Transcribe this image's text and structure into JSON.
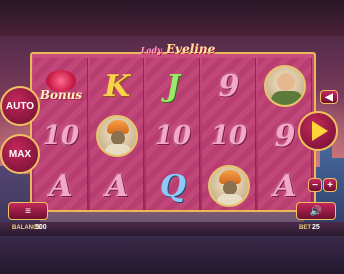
{
  "game": {
    "logo_text": "Eveline",
    "logo_prefix": "Lady"
  },
  "controls": {
    "auto_label": "AUTO",
    "max_label": "MAX",
    "back_label": "◀",
    "minus_label": "−",
    "plus_label": "+",
    "menu_label": "≡",
    "sound_label": "🔊"
  },
  "reels": [
    {
      "symbols": [
        "bonus",
        "10",
        "A"
      ]
    },
    {
      "symbols": [
        "K",
        "turban-man",
        "A"
      ]
    },
    {
      "symbols": [
        "J",
        "10",
        "Q"
      ]
    },
    {
      "symbols": [
        "9",
        "10",
        "turban-man"
      ]
    },
    {
      "symbols": [
        "bald-man",
        "9",
        "A"
      ]
    }
  ],
  "bonus_label": "Bonus",
  "symbol_text": {
    "K": "K",
    "J": "J",
    "Q": "Q",
    "A": "A",
    "ten": "10",
    "nine": "9"
  },
  "footer": {
    "balance_label": "BALANCE",
    "balance_value": "500",
    "bet_label": "BET",
    "bet_value": "25"
  },
  "colors": {
    "reel_bg": "#c94d7e",
    "frame_gold": "#e9b85a",
    "button_red": "#c2285a",
    "spin_arrow": "#ffd43b"
  }
}
